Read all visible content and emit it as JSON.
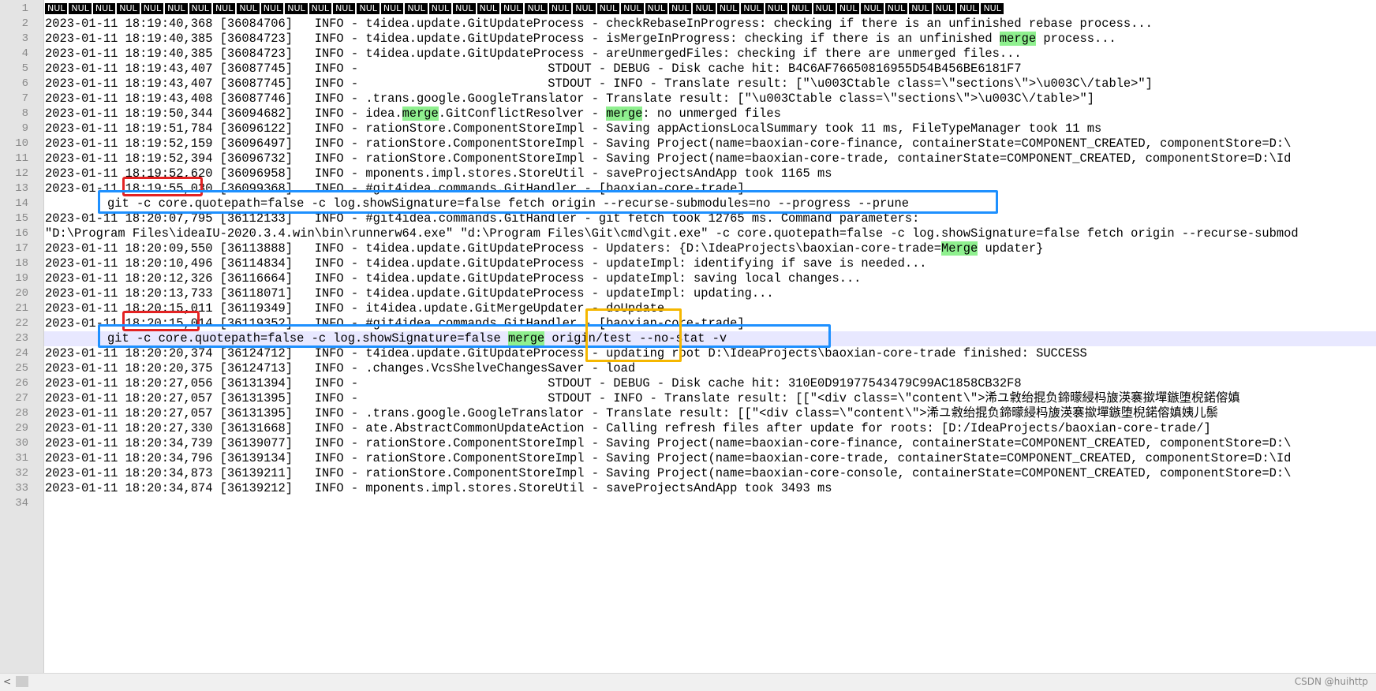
{
  "nul_label": "NUL",
  "nul_count": 40,
  "lines": [
    {
      "n": "1",
      "type": "nul"
    },
    {
      "n": "2",
      "parts": [
        {
          "t": "2023-01-11 18:19:40,368 [36084706]   INFO - t4idea.update.GitUpdateProcess - checkRebaseInProgress: checking if there is an unfinished rebase process..."
        }
      ]
    },
    {
      "n": "3",
      "parts": [
        {
          "t": "2023-01-11 18:19:40,385 [36084723]   INFO - t4idea.update.GitUpdateProcess - isMergeInProgress: checking if there is an unfinished "
        },
        {
          "t": "merge",
          "h": true
        },
        {
          "t": " process..."
        }
      ]
    },
    {
      "n": "4",
      "parts": [
        {
          "t": "2023-01-11 18:19:40,385 [36084723]   INFO - t4idea.update.GitUpdateProcess - areUnmergedFiles: checking if there are unmerged files..."
        }
      ]
    },
    {
      "n": "5",
      "parts": [
        {
          "t": "2023-01-11 18:19:43,407 [36087745]   INFO -                          STDOUT - DEBUG - Disk cache hit: B4C6AF76650816955D54B456BE6181F7"
        }
      ]
    },
    {
      "n": "6",
      "parts": [
        {
          "t": "2023-01-11 18:19:43,407 [36087745]   INFO -                          STDOUT - INFO - Translate result: [\"\\u003Ctable class=\\\"sections\\\">\\u003C\\/table>\"]"
        }
      ]
    },
    {
      "n": "7",
      "parts": [
        {
          "t": "2023-01-11 18:19:43,408 [36087746]   INFO - .trans.google.GoogleTranslator - Translate result: [\"\\u003Ctable class=\\\"sections\\\">\\u003C\\/table>\"]"
        }
      ]
    },
    {
      "n": "8",
      "parts": [
        {
          "t": "2023-01-11 18:19:50,344 [36094682]   INFO - idea."
        },
        {
          "t": "merge",
          "h": true
        },
        {
          "t": ".GitConflictResolver - "
        },
        {
          "t": "merge",
          "h": true
        },
        {
          "t": ": no unmerged files"
        }
      ]
    },
    {
      "n": "9",
      "parts": [
        {
          "t": "2023-01-11 18:19:51,784 [36096122]   INFO - rationStore.ComponentStoreImpl - Saving appActionsLocalSummary took 11 ms, FileTypeManager took 11 ms"
        }
      ]
    },
    {
      "n": "10",
      "parts": [
        {
          "t": "2023-01-11 18:19:52,159 [36096497]   INFO - rationStore.ComponentStoreImpl - Saving Project(name=baoxian-core-finance, containerState=COMPONENT_CREATED, componentStore=D:\\"
        }
      ]
    },
    {
      "n": "11",
      "parts": [
        {
          "t": "2023-01-11 18:19:52,394 [36096732]   INFO - rationStore.ComponentStoreImpl - Saving Project(name=baoxian-core-trade, containerState=COMPONENT_CREATED, componentStore=D:\\Id"
        }
      ]
    },
    {
      "n": "12",
      "parts": [
        {
          "t": "2023-01-11 18:19:52,620 [36096958]   INFO - mponents.impl.stores.StoreUtil - saveProjectsAndApp took 1165 ms"
        }
      ]
    },
    {
      "n": "13",
      "parts": [
        {
          "t": "2023-01-11 18:19:55,030 [36099368]   INFO - #git4idea.commands.GitHandler - [baoxian-core-trade]"
        }
      ]
    },
    {
      "n": "14",
      "indent": true,
      "parts": [
        {
          "t": "git -c core.quotepath=false -c log.showSignature=false fetch origin --recurse-submodules=no --progress --prune"
        }
      ]
    },
    {
      "n": "15",
      "parts": [
        {
          "t": "2023-01-11 18:20:07,795 [36112133]   INFO - #git4idea.commands.GitHandler - git fetch took 12765 ms. Command parameters:"
        }
      ]
    },
    {
      "n": "16",
      "parts": [
        {
          "t": "\"D:\\Program Files\\ideaIU-2020.3.4.win\\bin\\runnerw64.exe\" \"d:\\Program Files\\Git\\cmd\\git.exe\" -c core.quotepath=false -c log.showSignature=false fetch origin --recurse-submod"
        }
      ]
    },
    {
      "n": "17",
      "parts": [
        {
          "t": "2023-01-11 18:20:09,550 [36113888]   INFO - t4idea.update.GitUpdateProcess - Updaters: {D:\\IdeaProjects\\baoxian-core-trade="
        },
        {
          "t": "Merge",
          "h": true
        },
        {
          "t": " updater}"
        }
      ]
    },
    {
      "n": "18",
      "parts": [
        {
          "t": "2023-01-11 18:20:10,496 [36114834]   INFO - t4idea.update.GitUpdateProcess - updateImpl: identifying if save is needed..."
        }
      ]
    },
    {
      "n": "19",
      "parts": [
        {
          "t": "2023-01-11 18:20:12,326 [36116664]   INFO - t4idea.update.GitUpdateProcess - updateImpl: saving local changes..."
        }
      ]
    },
    {
      "n": "20",
      "parts": [
        {
          "t": "2023-01-11 18:20:13,733 [36118071]   INFO - t4idea.update.GitUpdateProcess - updateImpl: updating..."
        }
      ]
    },
    {
      "n": "21",
      "parts": [
        {
          "t": "2023-01-11 18:20:15,011 [36119349]   INFO - it4idea.update.GitMergeUpdater - doUpdate"
        }
      ]
    },
    {
      "n": "22",
      "parts": [
        {
          "t": "2023-01-11 18:20:15,014 [36119352]   INFO - #git4idea.commands.GitHandler - [baoxian-core-trade]"
        }
      ]
    },
    {
      "n": "23",
      "indent": true,
      "current": true,
      "parts": [
        {
          "t": "git -c core.quotepath=false -c log.showSignature=false "
        },
        {
          "t": "merge",
          "h": true
        },
        {
          "t": " origin/test --no-stat -v"
        }
      ]
    },
    {
      "n": "24",
      "parts": [
        {
          "t": "2023-01-11 18:20:20,374 [36124712]   INFO - t4idea.update.GitUpdateProcess - updating root D:\\IdeaProjects\\baoxian-core-trade finished: SUCCESS"
        }
      ]
    },
    {
      "n": "25",
      "parts": [
        {
          "t": "2023-01-11 18:20:20,375 [36124713]   INFO - .changes.VcsShelveChangesSaver - load"
        }
      ]
    },
    {
      "n": "26",
      "parts": [
        {
          "t": "2023-01-11 18:20:27,056 [36131394]   INFO -                          STDOUT - DEBUG - Disk cache hit: 310E0D91977543479C99AC1858CB32F8"
        }
      ]
    },
    {
      "n": "27",
      "parts": [
        {
          "t": "2023-01-11 18:20:27,057 [36131395]   INFO -                          STDOUT - INFO - Translate result: [[\"<div class=\\\"content\\\">浠ユ敹绐掍负鍗曚綅杩旇渶褰撳墠鏃堕棿鍩傛嫃"
        }
      ]
    },
    {
      "n": "28",
      "parts": [
        {
          "t": "2023-01-11 18:20:27,057 [36131395]   INFO - .trans.google.GoogleTranslator - Translate result: [[\"<div class=\\\"content\\\">浠ユ敹绐掍负鍗曚綅杩旇渶褰撳墠鏃堕棿鍩傛嫃姨儿鬃"
        }
      ]
    },
    {
      "n": "29",
      "parts": [
        {
          "t": "2023-01-11 18:20:27,330 [36131668]   INFO - ate.AbstractCommonUpdateAction - Calling refresh files after update for roots: [D:/IdeaProjects/baoxian-core-trade/]"
        }
      ]
    },
    {
      "n": "30",
      "parts": [
        {
          "t": "2023-01-11 18:20:34,739 [36139077]   INFO - rationStore.ComponentStoreImpl - Saving Project(name=baoxian-core-finance, containerState=COMPONENT_CREATED, componentStore=D:\\"
        }
      ]
    },
    {
      "n": "31",
      "parts": [
        {
          "t": "2023-01-11 18:20:34,796 [36139134]   INFO - rationStore.ComponentStoreImpl - Saving Project(name=baoxian-core-trade, containerState=COMPONENT_CREATED, componentStore=D:\\Id"
        }
      ]
    },
    {
      "n": "32",
      "parts": [
        {
          "t": "2023-01-11 18:20:34,873 [36139211]   INFO - rationStore.ComponentStoreImpl - Saving Project(name=baoxian-core-console, containerState=COMPONENT_CREATED, componentStore=D:\\"
        }
      ]
    },
    {
      "n": "33",
      "parts": [
        {
          "t": "2023-01-11 18:20:34,874 [36139212]   INFO - mponents.impl.stores.StoreUtil - saveProjectsAndApp took 3493 ms"
        }
      ]
    },
    {
      "n": "34",
      "parts": [
        {
          "t": ""
        }
      ]
    }
  ],
  "annotations": [
    {
      "name": "red-box-timestamp-line13",
      "color": "red"
    },
    {
      "name": "blue-box-fetch-command",
      "color": "blue"
    },
    {
      "name": "red-box-timestamp-line22",
      "color": "red"
    },
    {
      "name": "blue-box-merge-command",
      "color": "blue"
    },
    {
      "name": "orange-box-origin-test",
      "color": "orange"
    }
  ],
  "scrollbar": {
    "left_arrow": "<"
  },
  "watermark": "CSDN @huihttp"
}
